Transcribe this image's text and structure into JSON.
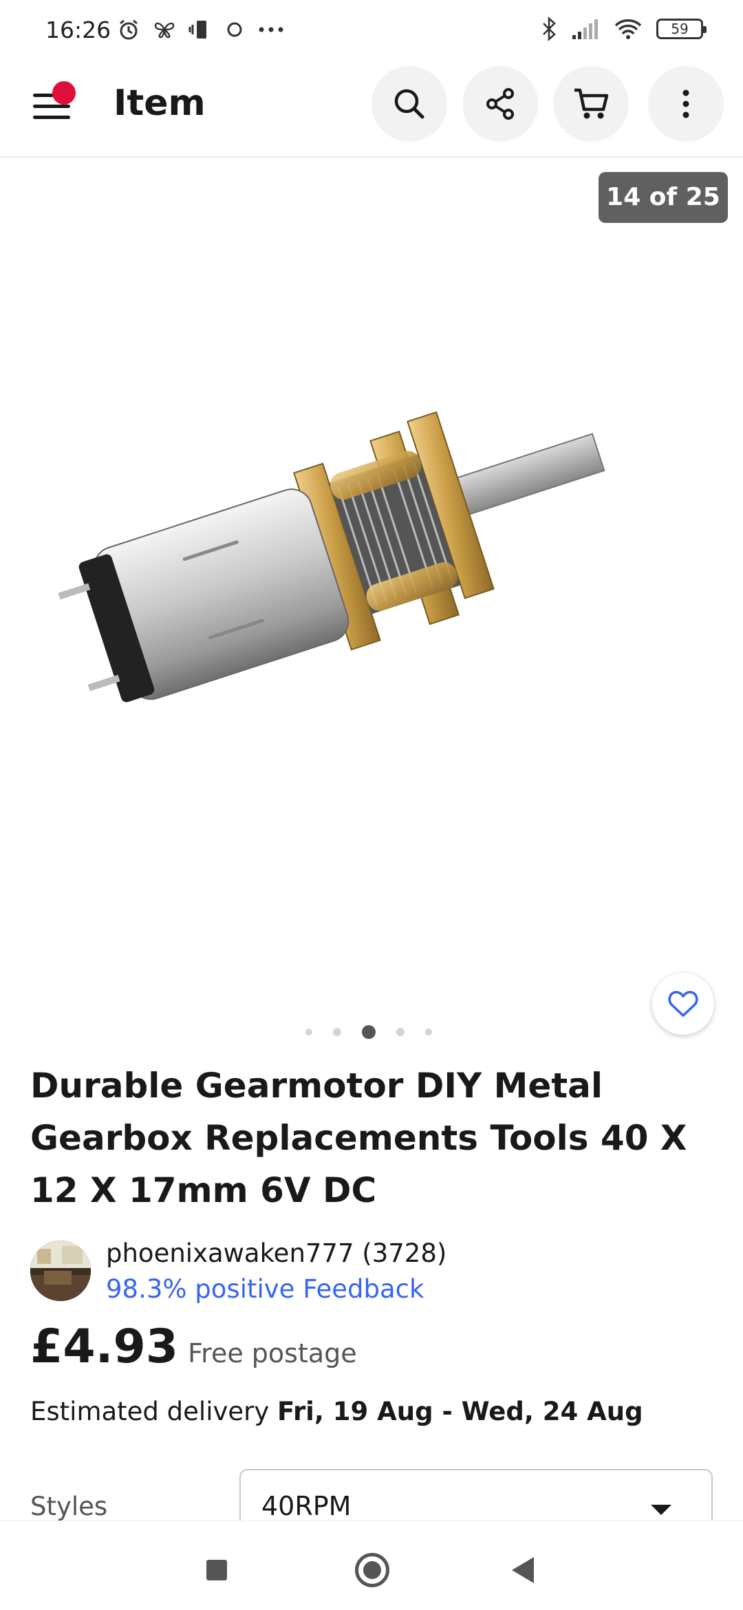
{
  "status_bar": {
    "time": "16:26",
    "battery": "59",
    "left_icons": [
      "alarm-icon",
      "butterfly-icon",
      "vibrate-icon",
      "circle-icon",
      "more-icon"
    ],
    "right_icons": [
      "bluetooth-icon",
      "signal-icon",
      "wifi-icon",
      "battery-icon"
    ]
  },
  "header": {
    "title": "Item",
    "notification_color": "#e0103a",
    "actions": [
      "search-icon",
      "share-icon",
      "cart-icon",
      "more-vertical-icon"
    ]
  },
  "gallery": {
    "counter": "14 of 25",
    "dots_count": 5,
    "active_dot": 3
  },
  "product": {
    "title": "Durable Gearmotor DIY Metal Gearbox Replacements Tools 40 X 12 X 17mm 6V DC",
    "seller_name": "phoenixawaken777 (3728)",
    "seller_feedback": "98.3% positive Feedback",
    "price": "£4.93",
    "postage": "Free postage",
    "delivery_label": "Estimated delivery",
    "delivery_dates": "Fri, 19 Aug - Wed, 24 Aug",
    "styles_label": "Styles",
    "style_selected": "40RPM"
  },
  "colors": {
    "link": "#3665f3",
    "text": "#191919",
    "badge_bg": "#606060"
  }
}
